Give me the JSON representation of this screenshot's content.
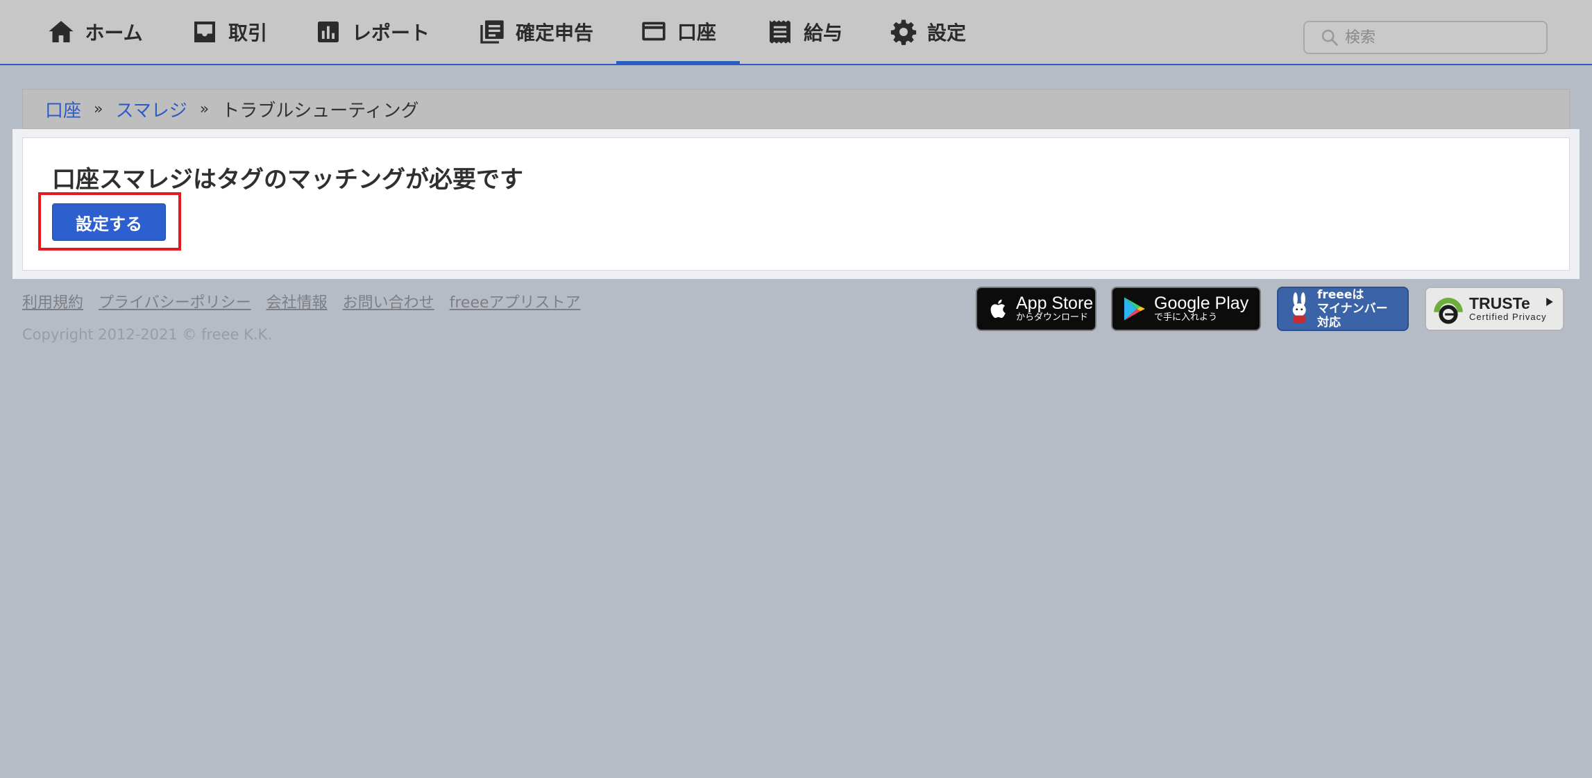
{
  "nav": {
    "items": [
      {
        "label": "ホーム",
        "icon": "home-icon"
      },
      {
        "label": "取引",
        "icon": "inbox-icon"
      },
      {
        "label": "レポート",
        "icon": "bar-chart-icon"
      },
      {
        "label": "確定申告",
        "icon": "documents-icon"
      },
      {
        "label": "口座",
        "icon": "credit-card-icon",
        "active": true
      },
      {
        "label": "給与",
        "icon": "receipt-icon"
      },
      {
        "label": "設定",
        "icon": "gear-icon"
      }
    ],
    "search_placeholder": "検索"
  },
  "breadcrumb": {
    "items": [
      "口座",
      "スマレジ"
    ],
    "separator": "»",
    "current": "トラブルシューティング"
  },
  "main": {
    "title": "口座スマレジはタグのマッチングが必要です",
    "button_label": "設定する"
  },
  "footer": {
    "links": [
      "利用規約",
      "プライバシーポリシー",
      "会社情報",
      "お問い合わせ",
      "freeeアプリストア"
    ],
    "copyright": "Copyright 2012-2021 © freee K.K.",
    "badges": {
      "app_store": {
        "big": "App Store",
        "small": "からダウンロード"
      },
      "google_play": {
        "big": "Google Play",
        "small": "で手に入れよう"
      },
      "mynumber": {
        "line1": "freeeは",
        "line2": "マイナンバー",
        "line3": "対応"
      },
      "truste": {
        "big": "TRUSTe",
        "small": "Certified Privacy"
      }
    }
  },
  "colors": {
    "accent": "#2d5bc4",
    "highlight": "#e8161d",
    "nav_bg": "#c7c7c7",
    "page_bg": "#b6bcc6"
  }
}
